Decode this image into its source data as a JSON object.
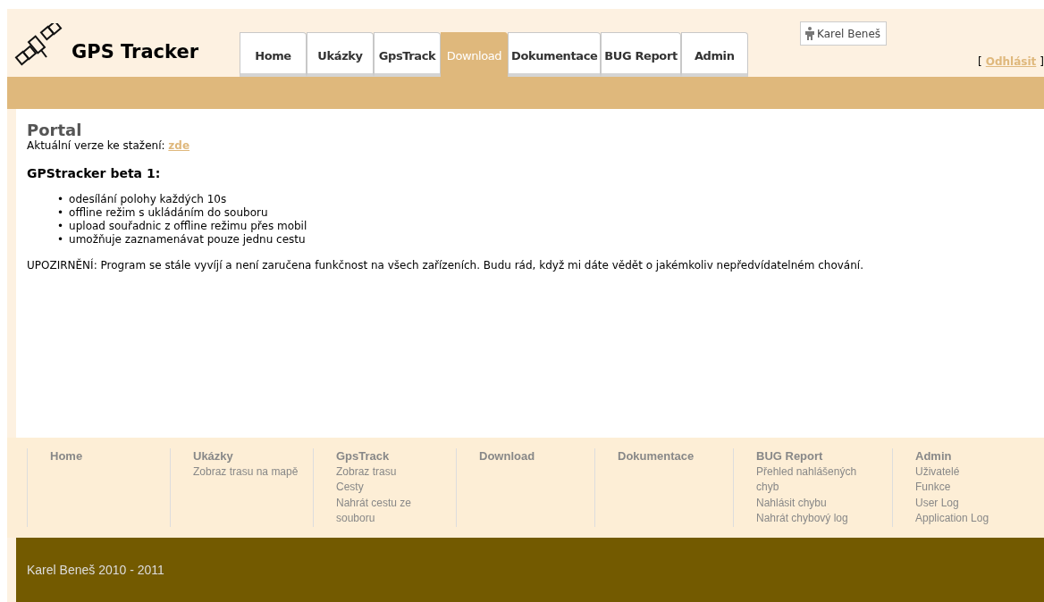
{
  "header": {
    "title": "GPS Tracker",
    "tabs": [
      {
        "label": "Home",
        "selected": false
      },
      {
        "label": "Ukázky",
        "selected": false
      },
      {
        "label": "GpsTrack",
        "selected": false
      },
      {
        "label": "Download",
        "selected": true
      },
      {
        "label": "Dokumentace",
        "selected": false
      },
      {
        "label": "BUG Report",
        "selected": false
      },
      {
        "label": "Admin",
        "selected": false
      }
    ],
    "user": "Karel Beneš",
    "logout": {
      "open": "[",
      "link": "Odhlásit",
      "close": "]"
    }
  },
  "content": {
    "heading": "Portal",
    "download_line": {
      "text": "Aktuální verze ke stažení:",
      "link": "zde"
    },
    "subheading": "GPStracker beta 1:",
    "features": [
      {
        "marker": "•",
        "text": "odesílání polohy každých 10s"
      },
      {
        "marker": "•",
        "text": "offline režim s ukládáním do souboru"
      },
      {
        "marker": "•",
        "text": "upload souřadnic z offline režimu přes mobil"
      },
      {
        "marker": "•",
        "text": "umožňuje zaznamenávat pouze jednu cestu"
      }
    ],
    "warning": "UPOZIRNĚNÍ: Program se stále vyvíjí a není zaručena funkčnost na všech zařízeních. Budu rád, když mi dáte vědět o jakémkoliv nepředvídatelném chování."
  },
  "footer_nav": [
    {
      "title": "Home"
    },
    {
      "title": "Ukázky",
      "links": [
        "Zobraz trasu na mapě"
      ]
    },
    {
      "title": "GpsTrack",
      "links": [
        "Zobraz trasu",
        "Cesty",
        "Nahrát cestu ze souboru"
      ]
    },
    {
      "title": "Download"
    },
    {
      "title": "Dokumentace"
    },
    {
      "title": "BUG Report",
      "links": [
        "Přehled nahlášených chyb",
        "Nahlásit chybu",
        "Nahrát chybový log"
      ]
    },
    {
      "title": "Admin",
      "links": [
        "Uživatelé",
        "Funkce",
        "User Log",
        "Application Log"
      ]
    }
  ],
  "copyright": "Karel Beneš 2010 - 2011"
}
